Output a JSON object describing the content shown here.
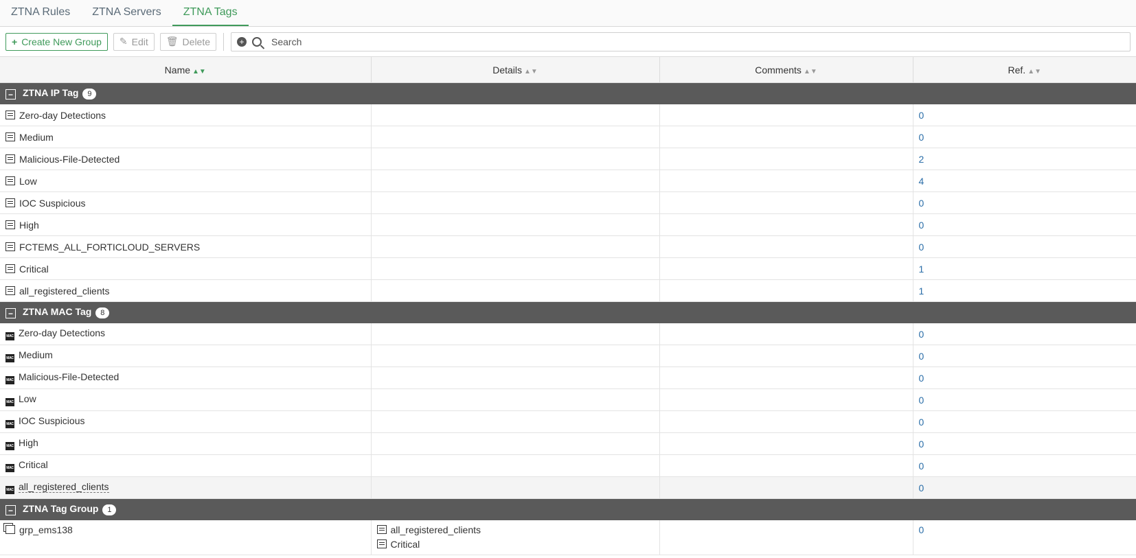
{
  "tabs": [
    {
      "label": "ZTNA Rules",
      "active": false
    },
    {
      "label": "ZTNA Servers",
      "active": false
    },
    {
      "label": "ZTNA Tags",
      "active": true
    }
  ],
  "toolbar": {
    "create_label": "Create New Group",
    "edit_label": "Edit",
    "delete_label": "Delete",
    "search_placeholder": "Search"
  },
  "columns": {
    "name": "Name",
    "details": "Details",
    "comments": "Comments",
    "ref": "Ref."
  },
  "groups": {
    "ip": {
      "title": "ZTNA IP Tag",
      "count": "9",
      "rows": [
        {
          "name": "Zero-day Detections",
          "ref": "0"
        },
        {
          "name": "Medium",
          "ref": "0"
        },
        {
          "name": "Malicious-File-Detected",
          "ref": "2"
        },
        {
          "name": "Low",
          "ref": "4"
        },
        {
          "name": "IOC Suspicious",
          "ref": "0"
        },
        {
          "name": "High",
          "ref": "0"
        },
        {
          "name": "FCTEMS_ALL_FORTICLOUD_SERVERS",
          "ref": "0"
        },
        {
          "name": "Critical",
          "ref": "1"
        },
        {
          "name": "all_registered_clients",
          "ref": "1"
        }
      ]
    },
    "mac": {
      "title": "ZTNA MAC Tag",
      "count": "8",
      "rows": [
        {
          "name": "Zero-day Detections",
          "ref": "0"
        },
        {
          "name": "Medium",
          "ref": "0"
        },
        {
          "name": "Malicious-File-Detected",
          "ref": "0"
        },
        {
          "name": "Low",
          "ref": "0"
        },
        {
          "name": "IOC Suspicious",
          "ref": "0"
        },
        {
          "name": "High",
          "ref": "0"
        },
        {
          "name": "Critical",
          "ref": "0"
        },
        {
          "name": "all_registered_clients",
          "ref": "0"
        }
      ]
    },
    "taggroup": {
      "title": "ZTNA Tag Group",
      "count": "1",
      "rows": [
        {
          "name": "grp_ems138",
          "details": [
            "all_registered_clients",
            "Critical"
          ],
          "ref": "0"
        }
      ]
    }
  },
  "icons": {
    "ip_tag": "ip-tag-icon",
    "mac_tag": "mac-tag-icon",
    "tag_group": "tag-group-icon",
    "mac_icon_text": "MAC"
  },
  "colors": {
    "accent": "#3f9a5a",
    "group_header_bg": "#5a5a5a",
    "ref_link": "#2b6ea8"
  }
}
